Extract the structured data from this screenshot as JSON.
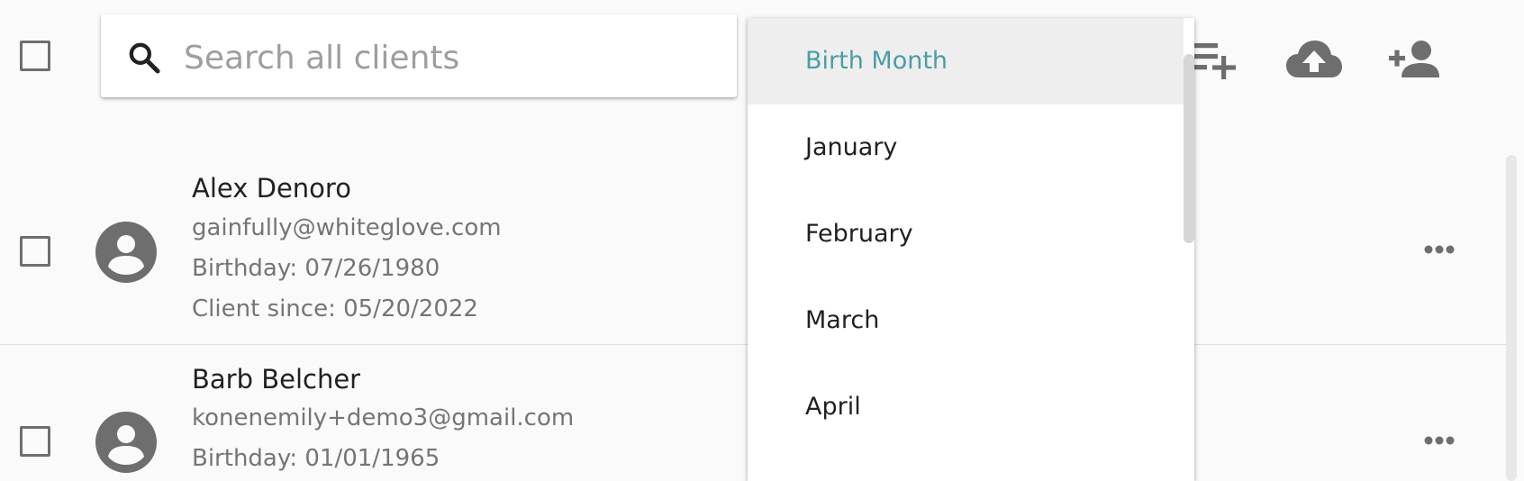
{
  "search": {
    "placeholder": "Search all clients",
    "value": ""
  },
  "toolbar": {
    "select_all_icon": "checkbox-outline",
    "add_to_list_icon": "playlist-add-icon",
    "upload_icon": "cloud-upload-icon",
    "add_client_icon": "person-add-icon"
  },
  "clients": [
    {
      "name": "Alex Denoro",
      "email": "gainfully@whiteglove.com",
      "birthday": "Birthday: 07/26/1980",
      "client_since": "Client since: 05/20/2022"
    },
    {
      "name": "Barb Belcher",
      "email": "konenemily+demo3@gmail.com",
      "birthday": "Birthday: 01/01/1965"
    }
  ],
  "dropdown": {
    "options": [
      "Birth Month",
      "January",
      "February",
      "March",
      "April"
    ],
    "selected": "Birth Month"
  },
  "colors": {
    "accent": "#4a9ea6",
    "icon_gray": "#6e6e6e",
    "secondary_text": "#757575"
  }
}
